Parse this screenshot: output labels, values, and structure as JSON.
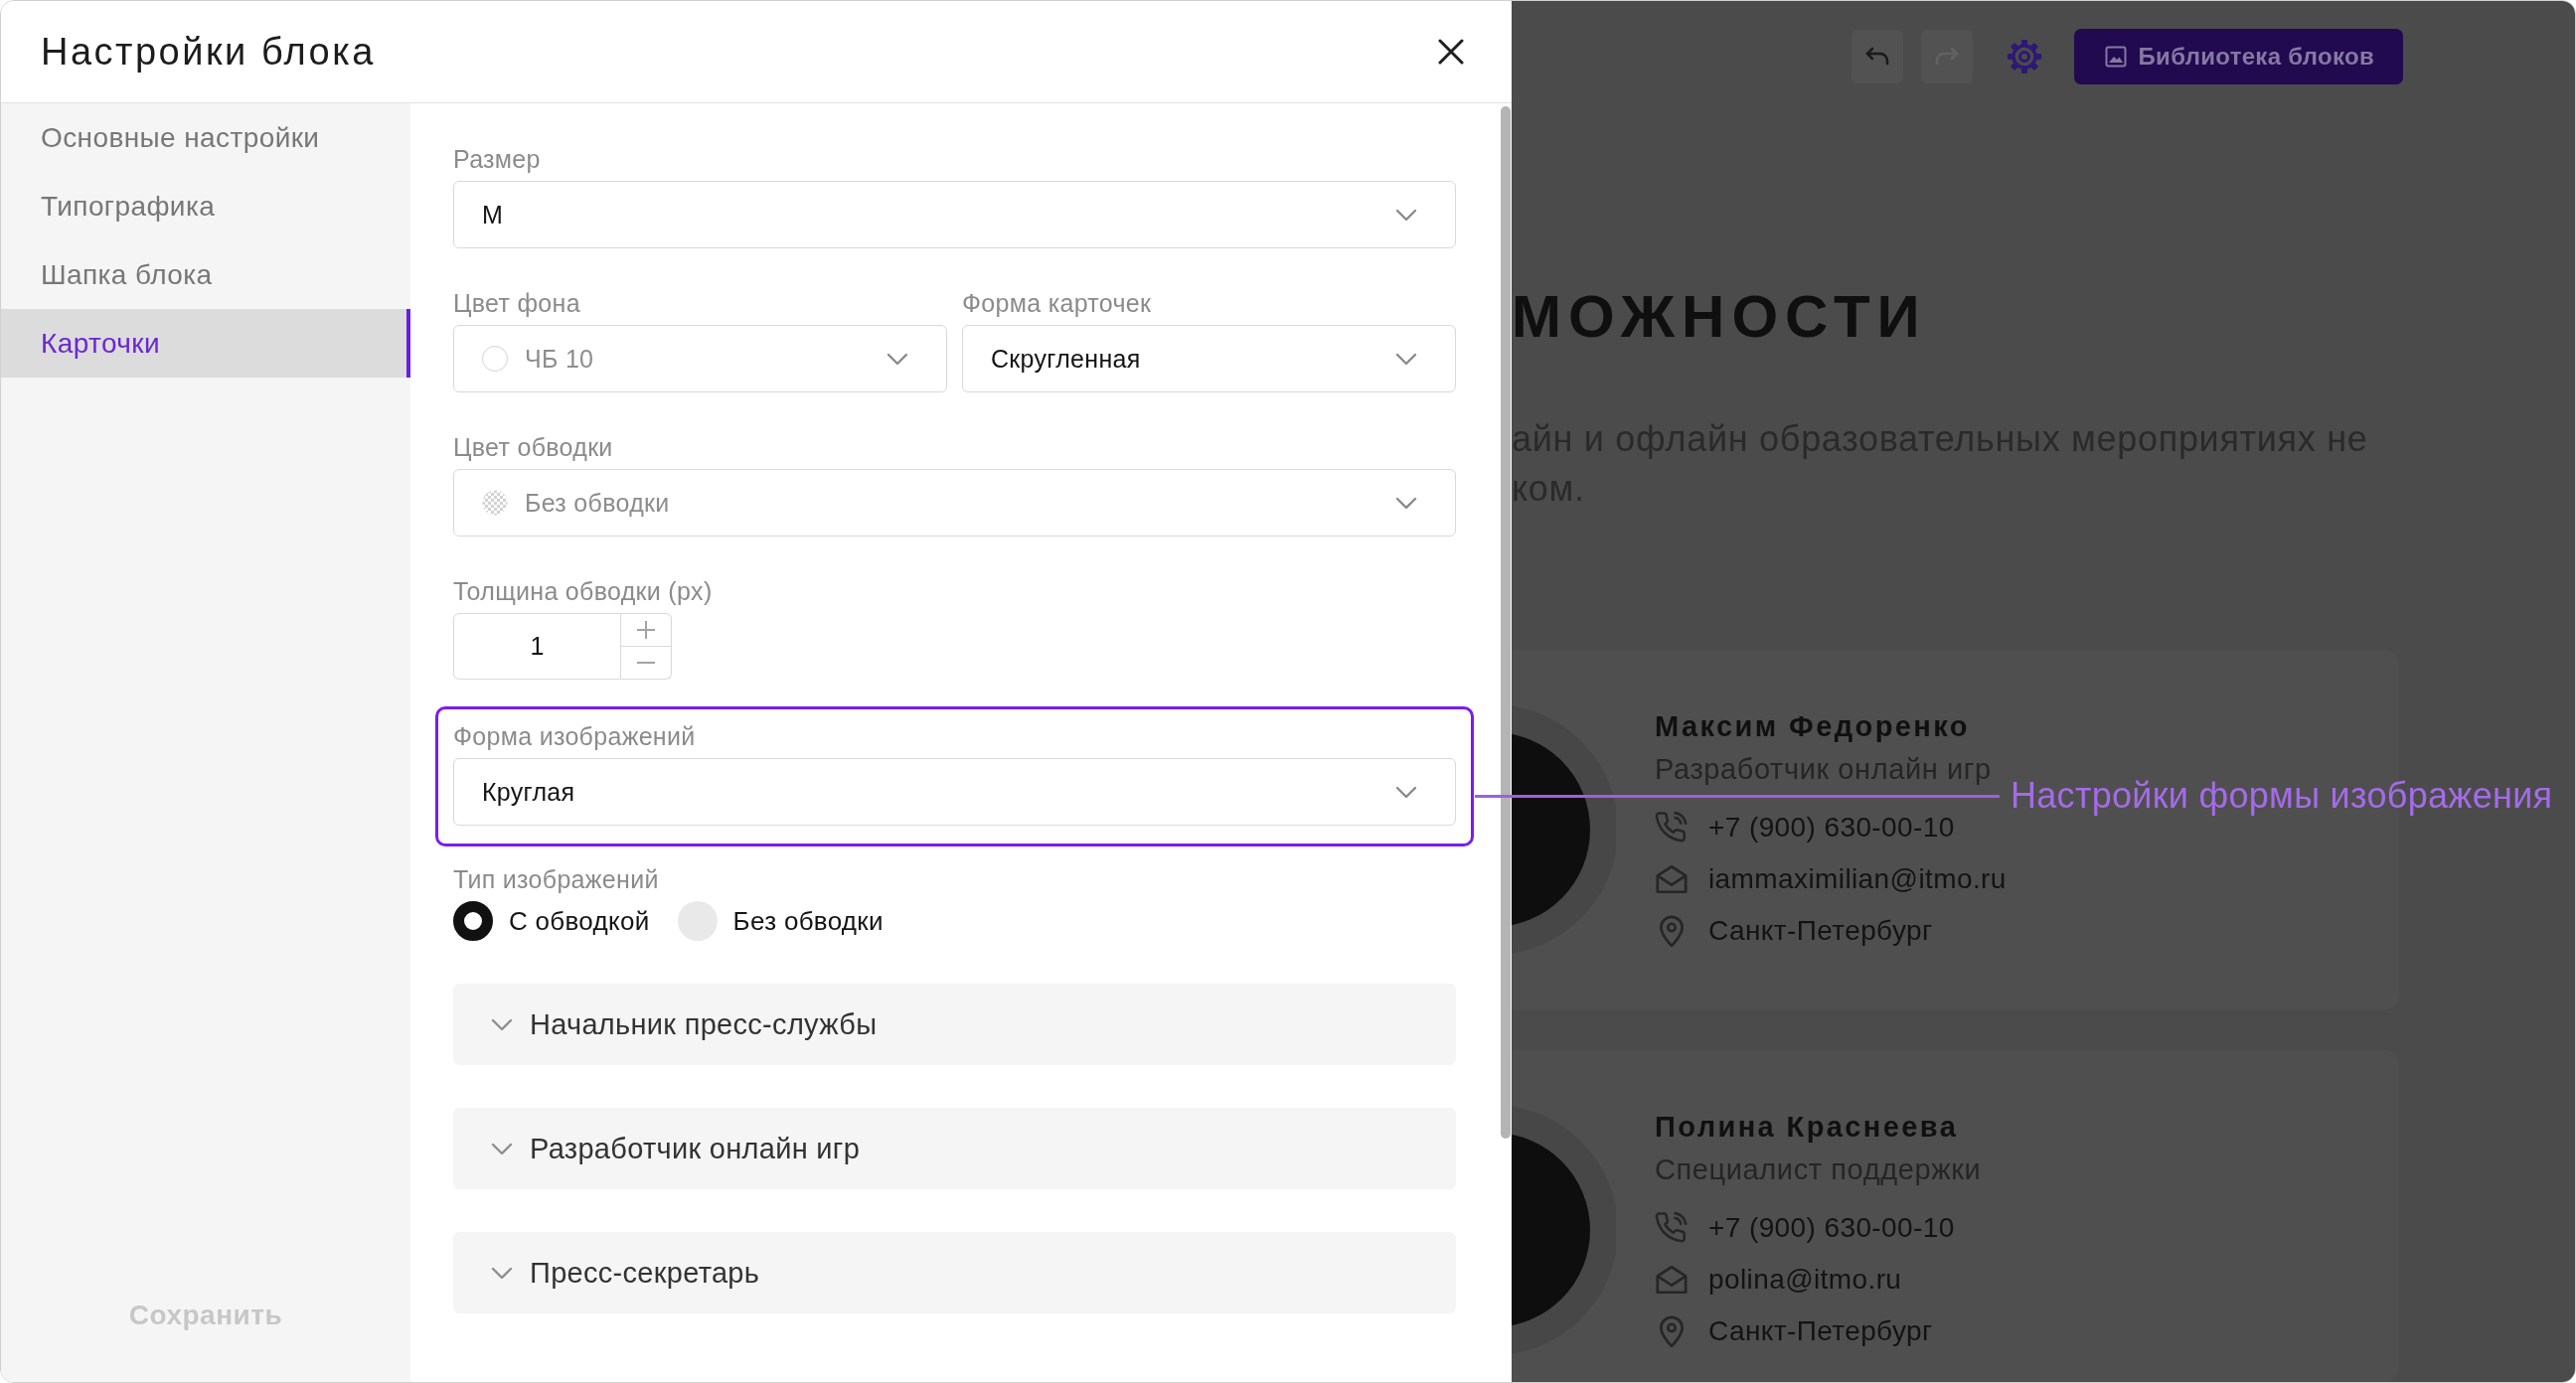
{
  "modal": {
    "title": "Настройки блока"
  },
  "sidebar": {
    "items": [
      {
        "label": "Основные настройки",
        "selected": false
      },
      {
        "label": "Типографика",
        "selected": false
      },
      {
        "label": "Шапка блока",
        "selected": false
      },
      {
        "label": "Карточки",
        "selected": true
      }
    ],
    "save_button": {
      "label": "Сохранить",
      "disabled": true
    }
  },
  "form": {
    "rows": [
      [
        {
          "kind": "select",
          "label": "Размер",
          "value": "М",
          "disabled": false,
          "highlighted": false
        }
      ],
      [
        {
          "kind": "color_select",
          "label": "Цвет фона",
          "value": "ЧБ 10",
          "color": "#ffffff",
          "disabled": true,
          "highlighted": false
        },
        {
          "kind": "select",
          "label": "Форма карточек",
          "value": "Скругленная",
          "disabled": false,
          "highlighted": false
        }
      ],
      [
        {
          "kind": "transparent_select",
          "label": "Цвет обводки",
          "value": "Без обводки",
          "disabled": true,
          "highlighted": false
        }
      ],
      [
        {
          "kind": "number",
          "label": "Толщина обводки (px)",
          "value": "1",
          "disabled": false,
          "highlighted": false
        }
      ],
      [
        {
          "kind": "select",
          "label": "Форма изображений",
          "value": "Круглая",
          "disabled": false,
          "highlighted": true
        }
      ],
      [
        {
          "kind": "radio",
          "label": "Тип изображений",
          "highlighted": false,
          "options": [
            {
              "label": "С обводкой",
              "selected": true
            },
            {
              "label": "Без обводки",
              "selected": false
            }
          ]
        }
      ]
    ],
    "sections": [
      {
        "title": "Начальник пресс-службы",
        "expanded": false
      },
      {
        "title": "Разработчик онлайн игр",
        "expanded": false
      },
      {
        "title": "Пресс-секретарь",
        "expanded": false
      }
    ]
  },
  "callout": {
    "text": "Настройки формы изображения"
  },
  "page": {
    "toolbar": [
      {
        "kind": "undo",
        "disabled": false
      },
      {
        "kind": "redo",
        "disabled": true
      },
      {
        "kind": "settings",
        "disabled": false
      }
    ],
    "library_button": {
      "label": "Библиотека блоков"
    },
    "heading": "МОЖНОСТИ",
    "intro_lines": [
      "айн и офлайн образовательных мероприятиях не",
      "ком."
    ],
    "cards": [
      {
        "name": "Максим Федоренко",
        "position": "Разработчик онлайн игр",
        "contacts": [
          {
            "kind": "phone",
            "text": "+7 (900) 630-00-10"
          },
          {
            "kind": "email",
            "text": "iammaximilian@itmo.ru"
          },
          {
            "kind": "location",
            "text": "Санкт-Петербург"
          }
        ]
      },
      {
        "name": "Полина Краснеева",
        "position": "Специалист поддержки",
        "contacts": [
          {
            "kind": "phone",
            "text": "+7 (900) 630-00-10"
          },
          {
            "kind": "email",
            "text": "polina@itmo.ru"
          },
          {
            "kind": "location",
            "text": "Санкт-Петербург"
          }
        ]
      }
    ]
  }
}
